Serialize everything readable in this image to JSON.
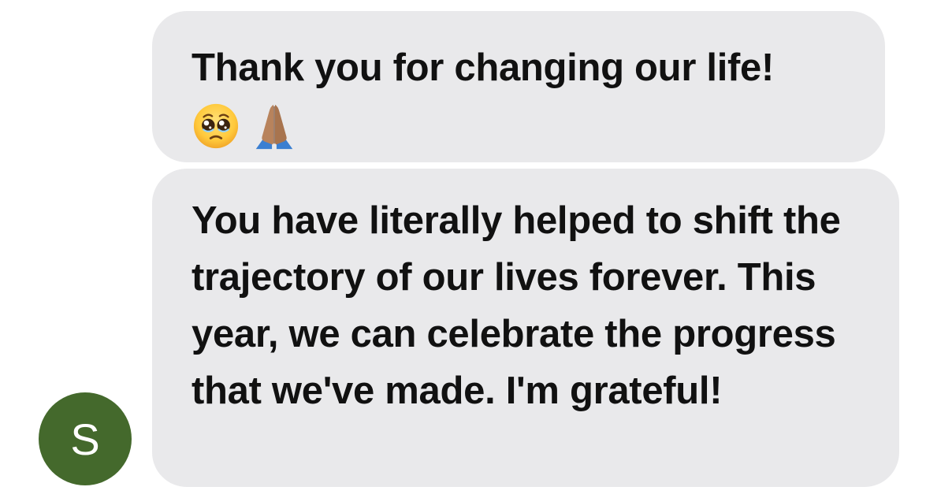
{
  "conversation": {
    "messages": [
      {
        "text": "Thank you for changing our life!",
        "emojis": [
          "pleading-face-icon",
          "folded-hands-icon"
        ]
      },
      {
        "text": "You have literally helped to shift the trajectory of our lives forever. This year, we can celebrate the progress that we've made. I'm grateful!"
      }
    ],
    "sender": {
      "initial": "S",
      "avatar_color": "#44692c"
    },
    "colors": {
      "bubble": "#e9e9eb",
      "text": "#111111",
      "background": "#ffffff"
    }
  }
}
